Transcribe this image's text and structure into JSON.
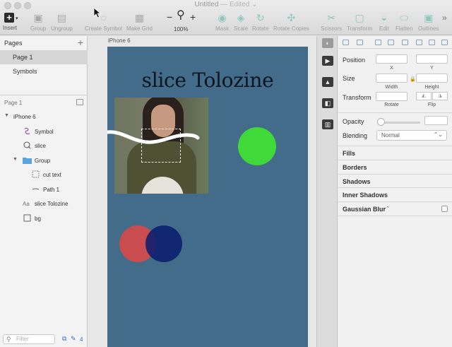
{
  "window": {
    "title": "Untitled",
    "status": "— Edited ⌄"
  },
  "toolbar": {
    "insert": "Insert",
    "group": "Group",
    "ungroup": "Ungroup",
    "create_symbol": "Create Symbol",
    "make_grid": "Make Grid",
    "zoom_value": "100%",
    "mask": "Mask",
    "scale": "Scale",
    "rotate": "Rotate",
    "rotate_copies": "Rotate Copies",
    "scissors": "Scissors",
    "transform": "Transform",
    "edit": "Edit",
    "flatten": "Flatten",
    "outlines": "Outlines",
    "more": "»"
  },
  "pages": {
    "header": "Pages",
    "add": "+",
    "items": [
      "Page 1",
      "Symbols"
    ],
    "current": "Page 1"
  },
  "layers": {
    "artboard": "iPhone 6",
    "items": [
      {
        "label": "Symbol",
        "icon": "symbol-icon"
      },
      {
        "label": "slice",
        "icon": "slice-icon"
      },
      {
        "label": "Group",
        "icon": "folder-icon"
      },
      {
        "label": "cut text",
        "icon": "dashed-rect-icon"
      },
      {
        "label": "Path 1",
        "icon": "path-icon"
      },
      {
        "label": "slice Tolozine",
        "icon": "text-icon"
      },
      {
        "label": "bg",
        "icon": "rect-icon"
      }
    ],
    "filter_placeholder": "Filter",
    "filter_count": "4"
  },
  "canvas": {
    "artboard_label": "iPhone 6",
    "title_text": "slice Tolozine"
  },
  "inspector": {
    "position": "Position",
    "x": "X",
    "y": "Y",
    "size": "Size",
    "width": "Width",
    "height": "Height",
    "transform": "Transform",
    "rotate": "Rotate",
    "flip": "Flip",
    "opacity": "Opacity",
    "blending": "Blending",
    "blending_value": "Normal",
    "sections": [
      "Fills",
      "Borders",
      "Shadows",
      "Inner Shadows",
      "Gaussian Blur"
    ],
    "blur_toggle": "⌃"
  },
  "colors": {
    "artboard_bg": "#436b8a",
    "green": "#3fd93a",
    "red": "#c94c4f",
    "blue": "#0a1e6e"
  }
}
